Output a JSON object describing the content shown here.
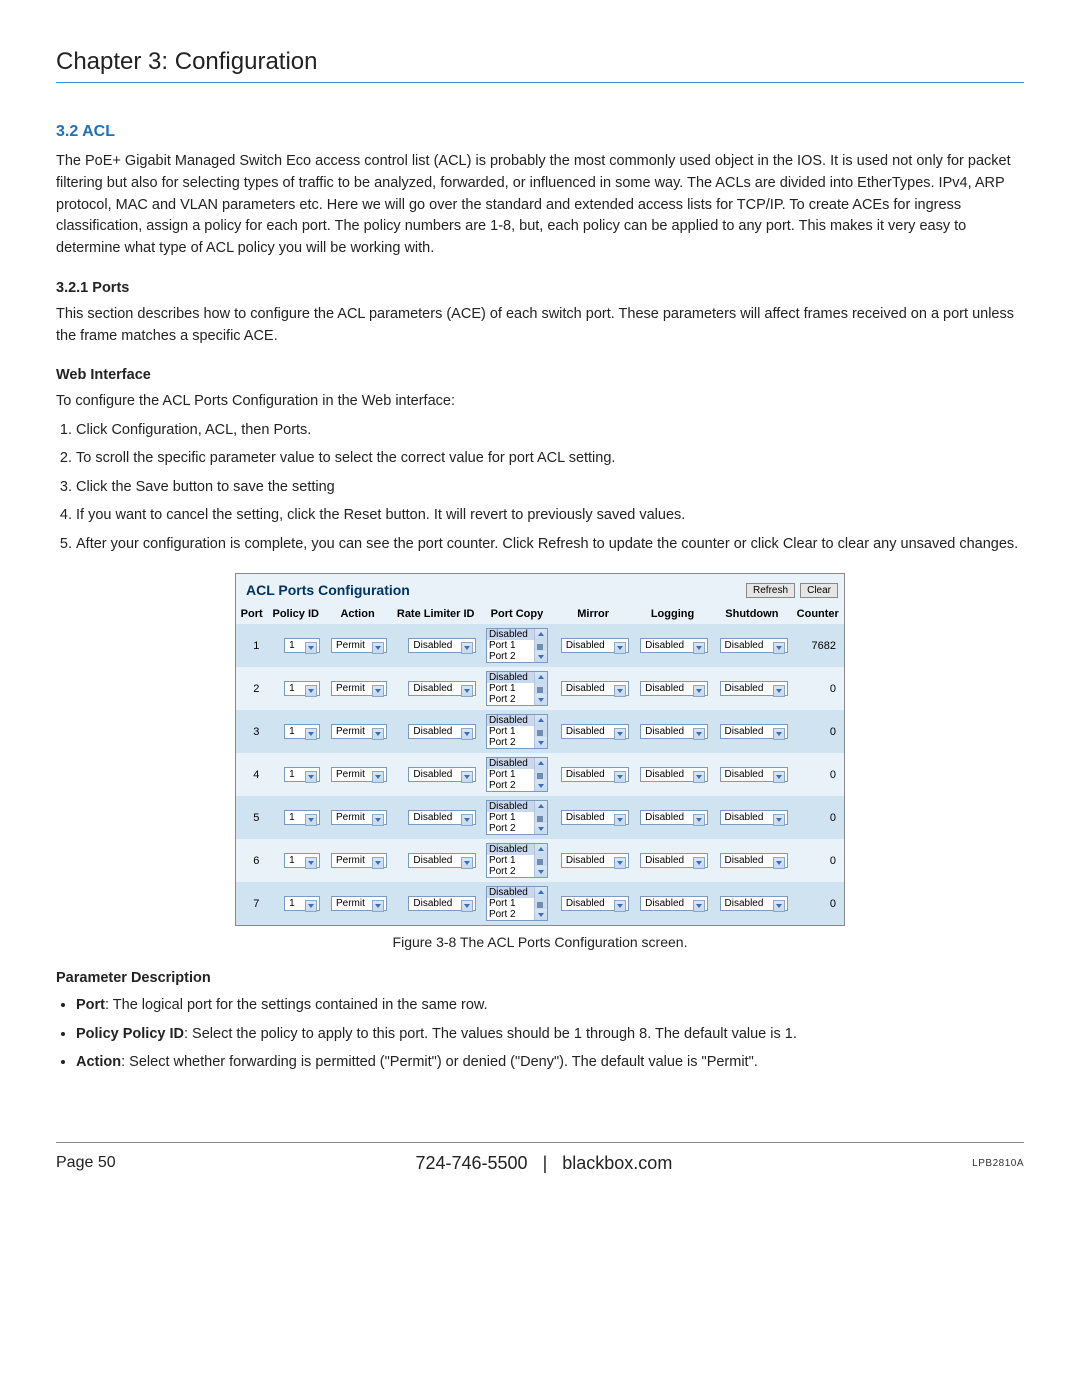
{
  "chapter_title": "Chapter 3: Configuration",
  "section_head": "3.2 ACL",
  "intro_text": "The PoE+ Gigabit Managed Switch Eco access control list (ACL) is probably the most commonly used object in the IOS. It is used not only for packet filtering but also for selecting types of traffic to be analyzed, forwarded, or influenced in some way. The ACLs are divided into EtherTypes. IPv4, ARP protocol, MAC and VLAN parameters etc. Here we will go over the standard and extended access lists for TCP/IP. To create ACEs for ingress classification, assign a policy for each port. The policy numbers are 1-8, but, each policy can be applied to any port. This makes it very easy to determine what type of ACL policy you will be working with.",
  "sub_ports_head": "3.2.1 Ports",
  "sub_ports_text": "This section describes how to configure the ACL parameters (ACE) of each switch port. These parameters will affect frames received on a port unless the frame matches a specific ACE.",
  "web_interface_head": "Web Interface",
  "web_interface_intro": "To configure the ACL Ports Configuration in the Web interface:",
  "steps": [
    "Click Configuration, ACL, then Ports.",
    "To scroll the specific parameter value to select the correct value for port ACL setting.",
    "Click the Save button to save the setting",
    "If you want to cancel the setting, click the Reset button. It will revert to previously saved values.",
    "After your configuration is complete, you can see the port counter. Click Refresh to update the counter or click Clear to clear any unsaved changes."
  ],
  "screenshot": {
    "title": "ACL Ports Configuration",
    "refresh": "Refresh",
    "clear": "Clear",
    "headers": [
      "Port",
      "Policy ID",
      "Action",
      "Rate Limiter ID",
      "Port Copy",
      "Mirror",
      "Logging",
      "Shutdown",
      "Counter"
    ],
    "listbox_items": [
      "Disabled",
      "Port 1",
      "Port 2"
    ],
    "rows": [
      {
        "port": "1",
        "policy": "1",
        "action": "Permit",
        "rate": "Disabled",
        "mirror": "Disabled",
        "logging": "Disabled",
        "shutdown": "Disabled",
        "counter": "7682"
      },
      {
        "port": "2",
        "policy": "1",
        "action": "Permit",
        "rate": "Disabled",
        "mirror": "Disabled",
        "logging": "Disabled",
        "shutdown": "Disabled",
        "counter": "0"
      },
      {
        "port": "3",
        "policy": "1",
        "action": "Permit",
        "rate": "Disabled",
        "mirror": "Disabled",
        "logging": "Disabled",
        "shutdown": "Disabled",
        "counter": "0"
      },
      {
        "port": "4",
        "policy": "1",
        "action": "Permit",
        "rate": "Disabled",
        "mirror": "Disabled",
        "logging": "Disabled",
        "shutdown": "Disabled",
        "counter": "0"
      },
      {
        "port": "5",
        "policy": "1",
        "action": "Permit",
        "rate": "Disabled",
        "mirror": "Disabled",
        "logging": "Disabled",
        "shutdown": "Disabled",
        "counter": "0"
      },
      {
        "port": "6",
        "policy": "1",
        "action": "Permit",
        "rate": "Disabled",
        "mirror": "Disabled",
        "logging": "Disabled",
        "shutdown": "Disabled",
        "counter": "0"
      },
      {
        "port": "7",
        "policy": "1",
        "action": "Permit",
        "rate": "Disabled",
        "mirror": "Disabled",
        "logging": "Disabled",
        "shutdown": "Disabled",
        "counter": "0"
      }
    ]
  },
  "figure_caption": "Figure 3-8 The ACL Ports Configuration screen.",
  "param_desc_head": "Parameter Description",
  "params": [
    {
      "b": "Port",
      "t": ": The logical port for the settings contained in the same row."
    },
    {
      "b": "Policy Policy ID",
      "t": ": Select the policy to apply to this port. The values should be 1 through 8. The default value is 1."
    },
    {
      "b": "Action",
      "t": ": Select whether forwarding is permitted (\"Permit\") or denied (\"Deny\"). The default value is \"Permit\"."
    }
  ],
  "footer": {
    "page_label": "Page 50",
    "phone": "724-746-5500",
    "sep": "|",
    "site": "blackbox.com",
    "code": "LPB2810A"
  }
}
